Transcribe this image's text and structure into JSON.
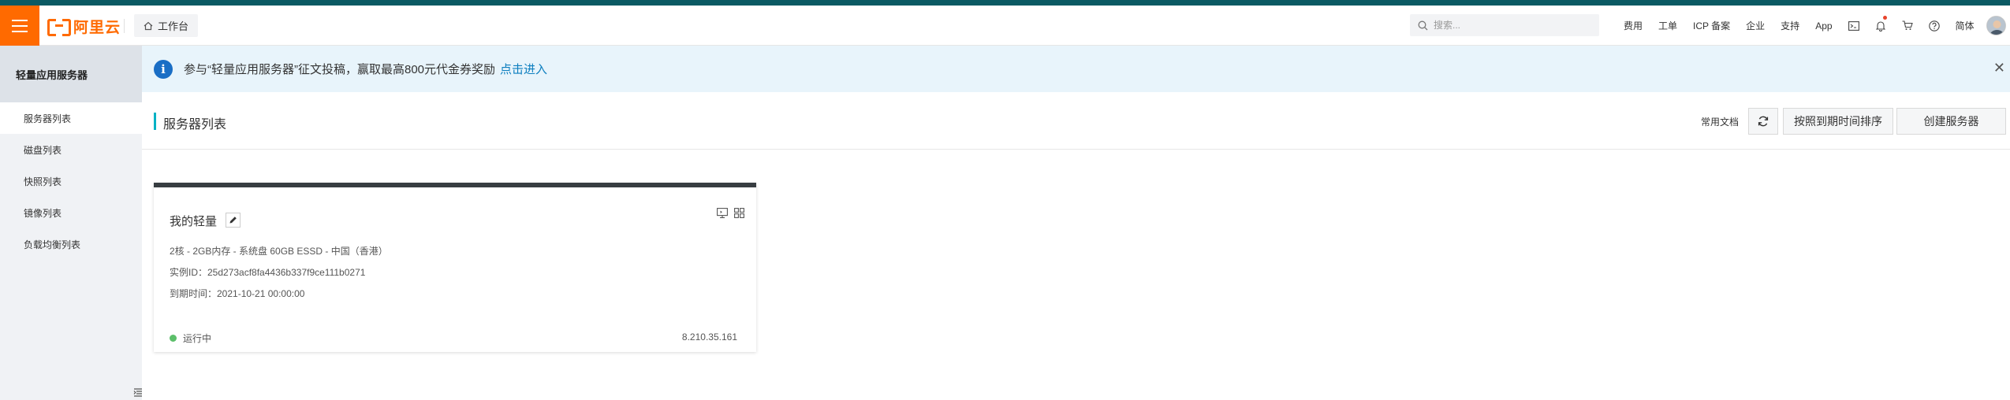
{
  "brand": {
    "logo_text": "阿里云",
    "accent": "#ff6a00"
  },
  "topbar": {
    "workbench_label": "工作台",
    "search_placeholder": "搜索...",
    "nav": [
      "费用",
      "工单",
      "ICP 备案",
      "企业",
      "支持",
      "App"
    ],
    "language": "简体"
  },
  "sidebar": {
    "title": "轻量应用服务器",
    "items": [
      {
        "label": "服务器列表"
      },
      {
        "label": "磁盘列表"
      },
      {
        "label": "快照列表"
      },
      {
        "label": "镜像列表"
      },
      {
        "label": "负载均衡列表"
      }
    ]
  },
  "banner": {
    "text": "参与“轻量应用服务器”征文投稿，赢取最高800元代金券奖励",
    "link": "点击进入",
    "close": "✕"
  },
  "page": {
    "title": "服务器列表",
    "doc_link": "常用文档",
    "sort_button": "按照到期时间排序",
    "create_button": "创建服务器"
  },
  "server": {
    "name": "我的轻量",
    "spec": "2核 - 2GB内存 - 系统盘 60GB ESSD - 中国（香港）",
    "instance_id": "实例ID：25d273acf8fa4436b337f9ce111b0271",
    "expires": "到期时间：2021-10-21 00:00:00",
    "status": "运行中",
    "status_color": "#5cbf6a",
    "ip": "8.210.35.161"
  }
}
